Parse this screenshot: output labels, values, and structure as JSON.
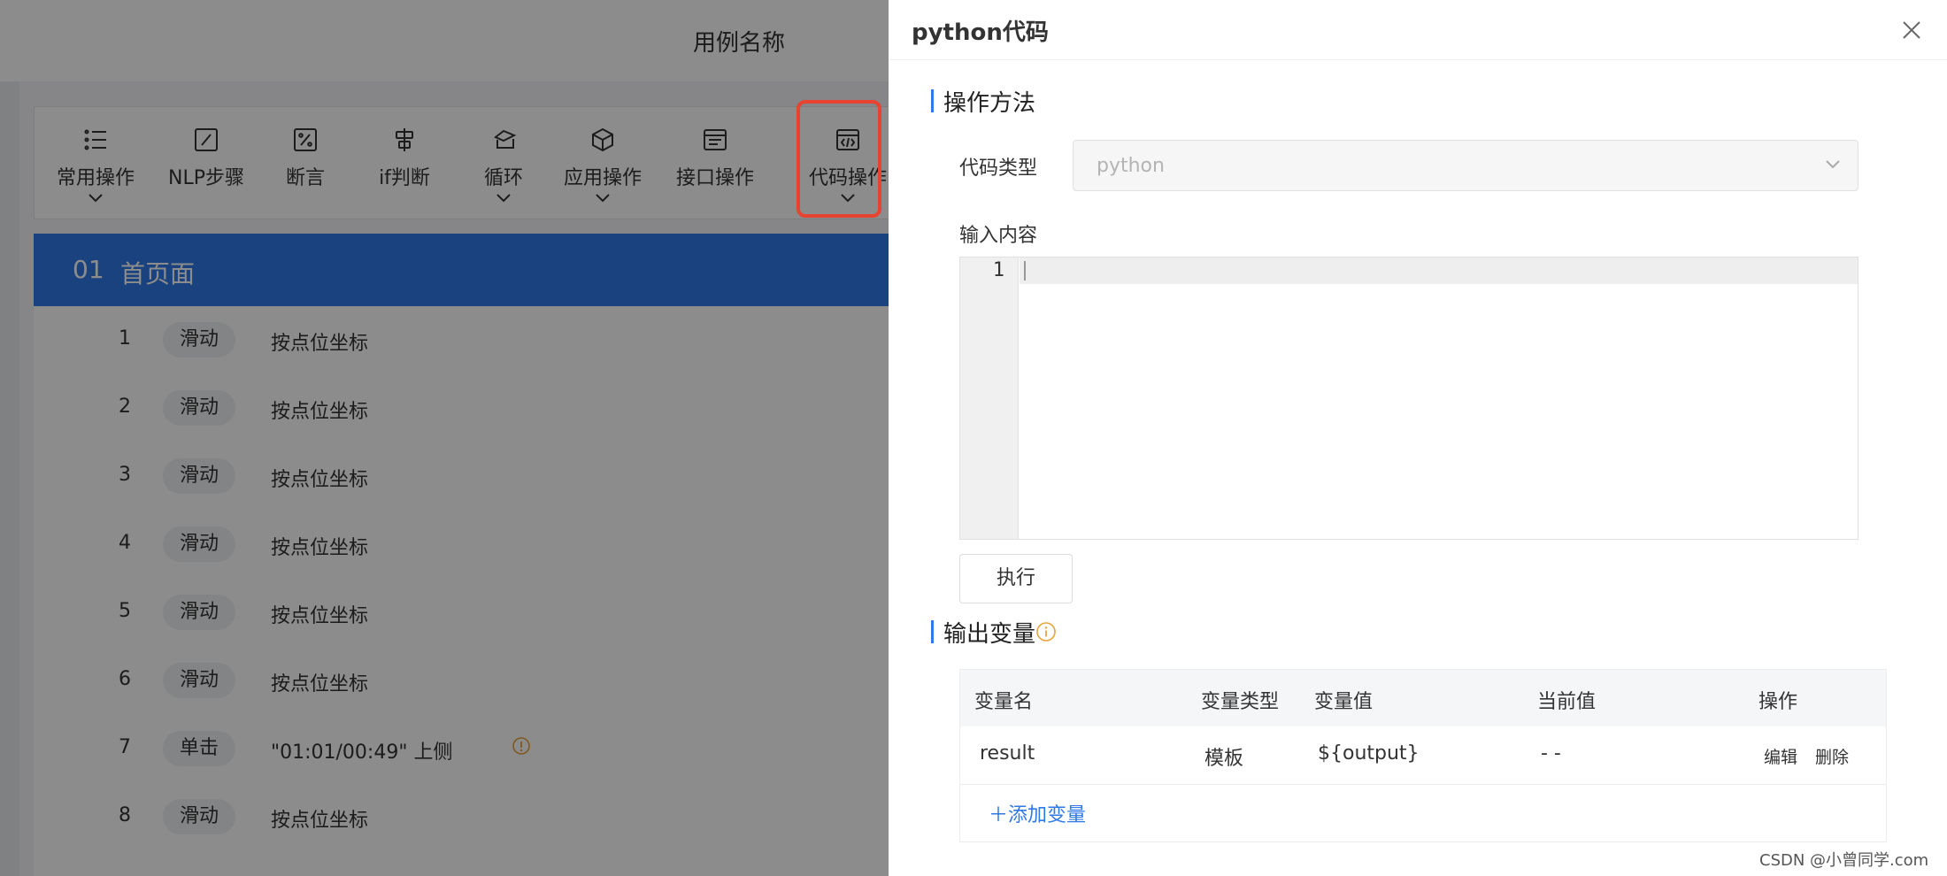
{
  "background": {
    "title": "用例名称",
    "toolbar": [
      {
        "label": "常用操作",
        "icon": "list-icon",
        "dropdown": true
      },
      {
        "label": "NLP步骤",
        "icon": "edit-square-icon",
        "dropdown": false
      },
      {
        "label": "断言",
        "icon": "percent-square-icon",
        "dropdown": false
      },
      {
        "label": "if判断",
        "icon": "branch-icon",
        "dropdown": false
      },
      {
        "label": "循环",
        "icon": "loop-icon",
        "dropdown": true
      },
      {
        "label": "应用操作",
        "icon": "cube-icon",
        "dropdown": true
      },
      {
        "label": "接口操作",
        "icon": "api-window-icon",
        "dropdown": false
      },
      {
        "label": "代码操作",
        "icon": "code-window-icon",
        "dropdown": true
      }
    ],
    "section": {
      "number": "01",
      "name": "首页面"
    },
    "steps": [
      {
        "index": "1",
        "tag": "滑动",
        "desc": "按点位坐标"
      },
      {
        "index": "2",
        "tag": "滑动",
        "desc": "按点位坐标"
      },
      {
        "index": "3",
        "tag": "滑动",
        "desc": "按点位坐标"
      },
      {
        "index": "4",
        "tag": "滑动",
        "desc": "按点位坐标"
      },
      {
        "index": "5",
        "tag": "滑动",
        "desc": "按点位坐标"
      },
      {
        "index": "6",
        "tag": "滑动",
        "desc": "按点位坐标"
      },
      {
        "index": "7",
        "tag": "单击",
        "desc": "\"01:01/00:49\" 上侧",
        "warning": true
      },
      {
        "index": "8",
        "tag": "滑动",
        "desc": "按点位坐标"
      }
    ]
  },
  "drawer": {
    "title": "python代码",
    "section_method": "操作方法",
    "code_type_label": "代码类型",
    "code_type_value": "python",
    "input_label": "输入内容",
    "editor_line": "1",
    "execute_label": "执行",
    "section_output": "输出变量",
    "table": {
      "headers": [
        "变量名",
        "变量类型",
        "变量值",
        "当前值",
        "操作"
      ],
      "rows": [
        {
          "name": "result",
          "type": "模板",
          "value": "${output}",
          "current": "- -",
          "edit": "编辑",
          "delete": "删除"
        }
      ]
    },
    "add_variable": "添加变量"
  },
  "watermark": "CSDN @小曾同学.com",
  "colors": {
    "accent": "#2f79e8",
    "highlight": "#e84330",
    "warning": "#e8a33d"
  }
}
